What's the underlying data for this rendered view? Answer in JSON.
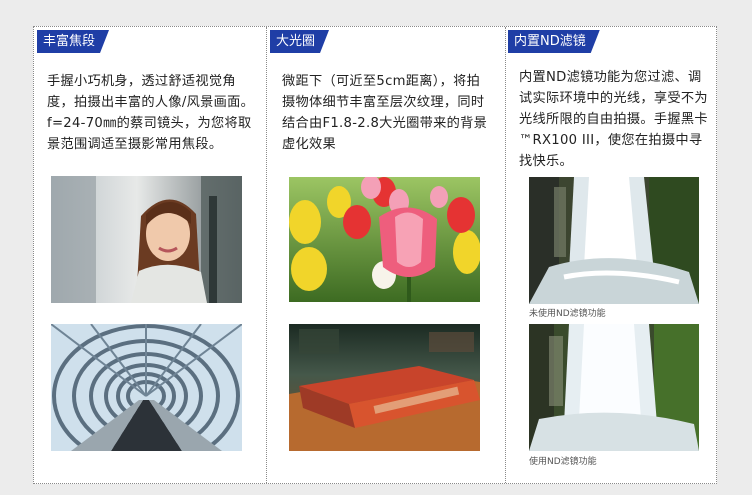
{
  "sections": [
    {
      "tag": "丰富焦段",
      "text": "手握小巧机身，透过舒适视觉角度，拍摄出丰富的人像/风景画面。f=24-70㎜的蔡司镜头，为您将取景范围调适至摄影常用焦段。",
      "images": [
        {
          "icon": "portrait-photo",
          "caption": ""
        },
        {
          "icon": "escalator-tunnel-photo",
          "caption": ""
        }
      ]
    },
    {
      "tag": "大光圈",
      "text": "微距下（可近至5cm距离），将拍摄物体细节丰富至层次纹理，同时结合由F1.8-2.8大光圈带来的背景虚化效果",
      "images": [
        {
          "icon": "tulips-photo",
          "caption": ""
        },
        {
          "icon": "book-photo",
          "caption": ""
        }
      ]
    },
    {
      "tag": "内置ND滤镜",
      "text": "内置ND滤镜功能为您过滤、调试实际环境中的光线，享受不为光线所限的自由拍摄。手握黑卡™RX100 III，使您在拍摄中寻找快乐。",
      "images": [
        {
          "icon": "waterfall-photo",
          "caption": "未使用ND滤镜功能"
        },
        {
          "icon": "waterfall-nd-photo",
          "caption": "使用ND滤镜功能"
        }
      ]
    }
  ],
  "colors": {
    "tag_bg": "#1f3ea6",
    "page_bg": "#ececec"
  }
}
